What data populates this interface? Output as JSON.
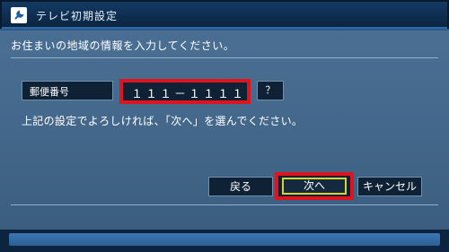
{
  "window": {
    "title": "テレビ初期設定",
    "icon": "settings-wrench-icon"
  },
  "form": {
    "intro": "お住まいの地域の情報を入力してください。",
    "postal_label": "郵便番号",
    "postal_value": "１１１－１１１１",
    "help_label": "？",
    "confirm_text": "上記の設定でよろしければ、「次へ」を選んでください。"
  },
  "buttons": {
    "back": "戻る",
    "next": "次へ",
    "cancel": "キャンセル"
  },
  "colors": {
    "highlight": "#e0141e",
    "focus": "#d4d33a",
    "panel": "#45698c"
  }
}
